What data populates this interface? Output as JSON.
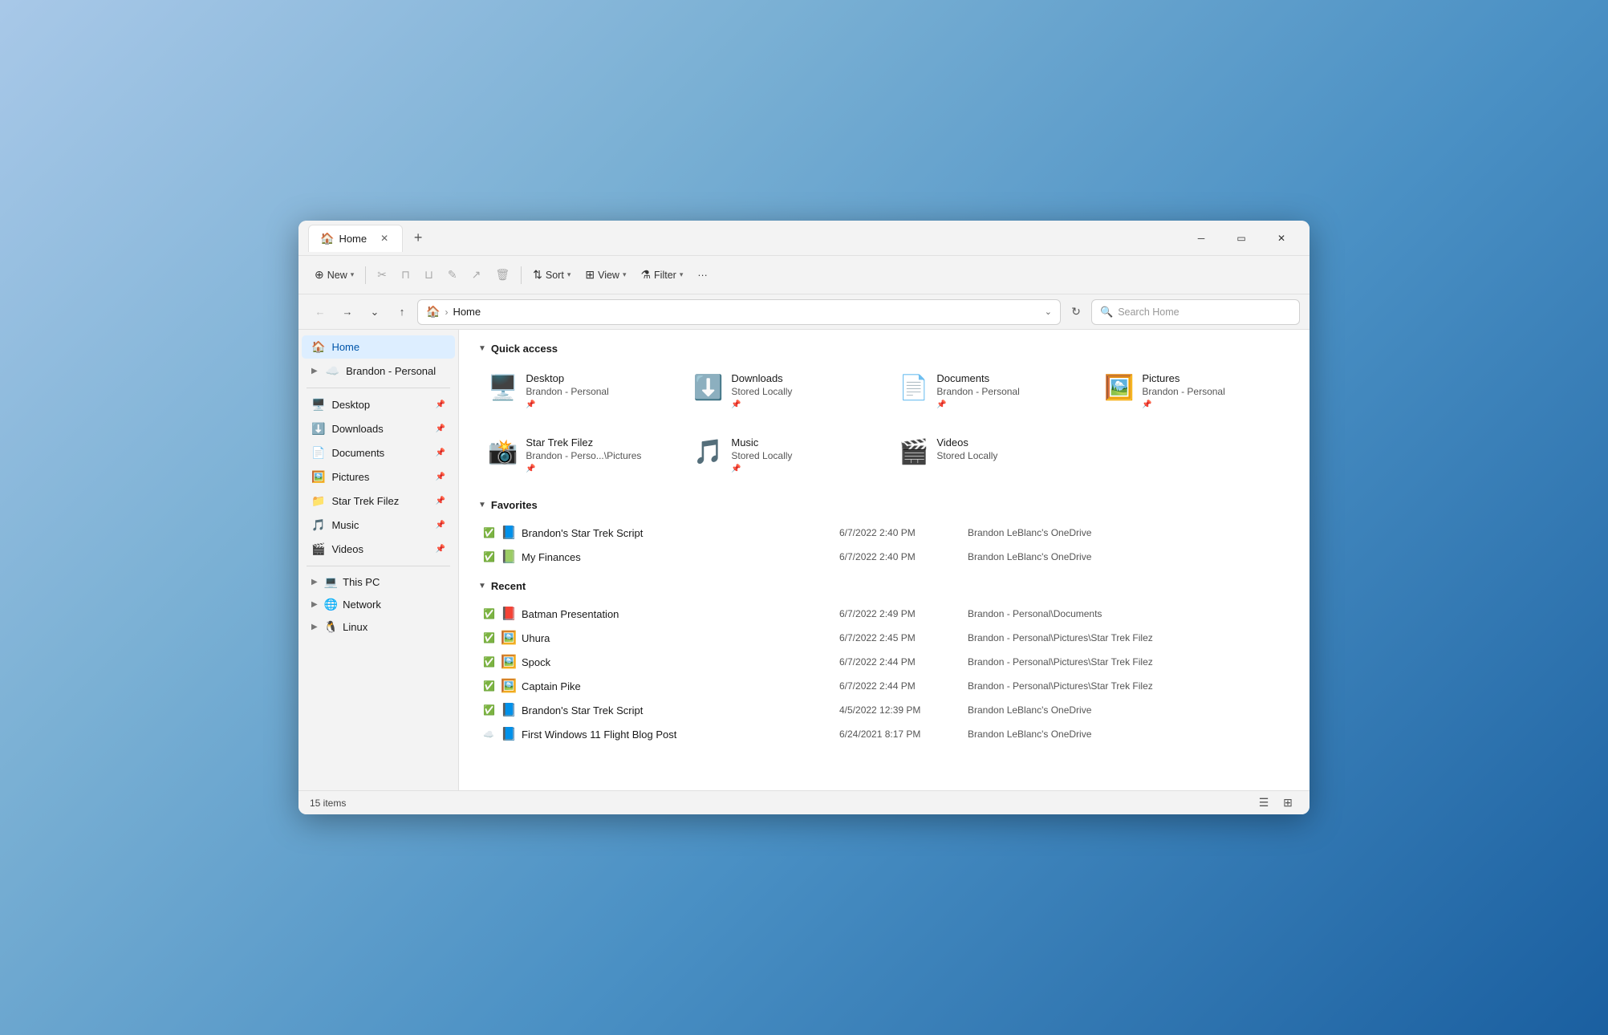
{
  "window": {
    "title": "Home",
    "tab_icon": "🏠"
  },
  "toolbar": {
    "new_label": "New",
    "sort_label": "Sort",
    "view_label": "View",
    "filter_label": "Filter",
    "more_label": "···"
  },
  "address": {
    "home_icon": "🏠",
    "separator": "›",
    "path": "Home",
    "search_placeholder": "Search Home"
  },
  "sidebar": {
    "home_label": "Home",
    "brandon_personal_label": "Brandon - Personal",
    "pinned_items": [
      {
        "icon": "🖥️",
        "label": "Desktop",
        "pin": true
      },
      {
        "icon": "⬇️",
        "label": "Downloads",
        "pin": true
      },
      {
        "icon": "📄",
        "label": "Documents",
        "pin": true
      },
      {
        "icon": "🖼️",
        "label": "Pictures",
        "pin": true
      },
      {
        "icon": "📁",
        "label": "Star Trek Filez",
        "pin": true
      },
      {
        "icon": "🎵",
        "label": "Music",
        "pin": true
      },
      {
        "icon": "🎬",
        "label": "Videos",
        "pin": true
      }
    ],
    "tree_items": [
      {
        "icon": "💻",
        "label": "This PC",
        "expandable": true
      },
      {
        "icon": "🌐",
        "label": "Network",
        "expandable": true
      },
      {
        "icon": "🐧",
        "label": "Linux",
        "expandable": true
      }
    ]
  },
  "quick_access": {
    "section_label": "Quick access",
    "items": [
      {
        "icon": "🖥️",
        "name": "Desktop",
        "sub": "Brandon - Personal",
        "color": "blue"
      },
      {
        "icon": "⬇️",
        "name": "Downloads",
        "sub": "Stored Locally",
        "color": "green"
      },
      {
        "icon": "📄",
        "name": "Documents",
        "sub": "Brandon - Personal",
        "color": "gray"
      },
      {
        "icon": "🖼️",
        "name": "Pictures",
        "sub": "Brandon - Personal",
        "color": "teal"
      },
      {
        "icon": "📸",
        "name": "Star Trek Filez",
        "sub": "Brandon - Perso...\\Pictures",
        "color": "yellow"
      },
      {
        "icon": "🎵",
        "name": "Music",
        "sub": "Stored Locally",
        "color": "orange"
      },
      {
        "icon": "🎬",
        "name": "Videos",
        "sub": "Stored Locally",
        "color": "purple"
      }
    ]
  },
  "favorites": {
    "section_label": "Favorites",
    "items": [
      {
        "status": "✅",
        "icon": "📘",
        "name": "Brandon's Star Trek Script",
        "date": "6/7/2022 2:40 PM",
        "location": "Brandon LeBlanc's OneDrive"
      },
      {
        "status": "✅",
        "icon": "📗",
        "name": "My Finances",
        "date": "6/7/2022 2:40 PM",
        "location": "Brandon LeBlanc's OneDrive"
      }
    ]
  },
  "recent": {
    "section_label": "Recent",
    "items": [
      {
        "status": "✅",
        "icon": "📕",
        "name": "Batman Presentation",
        "date": "6/7/2022 2:49 PM",
        "location": "Brandon - Personal\\Documents"
      },
      {
        "status": "✅",
        "icon": "🖼️",
        "name": "Uhura",
        "date": "6/7/2022 2:45 PM",
        "location": "Brandon - Personal\\Pictures\\Star Trek Filez"
      },
      {
        "status": "✅",
        "icon": "🖼️",
        "name": "Spock",
        "date": "6/7/2022 2:44 PM",
        "location": "Brandon - Personal\\Pictures\\Star Trek Filez"
      },
      {
        "status": "✅",
        "icon": "🖼️",
        "name": "Captain Pike",
        "date": "6/7/2022 2:44 PM",
        "location": "Brandon - Personal\\Pictures\\Star Trek Filez"
      },
      {
        "status": "✅",
        "icon": "📘",
        "name": "Brandon's Star Trek Script",
        "date": "4/5/2022 12:39 PM",
        "location": "Brandon LeBlanc's OneDrive"
      },
      {
        "status": "☁️",
        "icon": "📘",
        "name": "First Windows 11 Flight Blog Post",
        "date": "6/24/2021 8:17 PM",
        "location": "Brandon LeBlanc's OneDrive"
      }
    ]
  },
  "statusbar": {
    "items_count": "15 items"
  },
  "icons": {
    "back": "←",
    "forward": "→",
    "recent_locations": "˅",
    "up": "↑",
    "refresh": "↻",
    "sort": "⇅",
    "view": "⊞",
    "filter": "⚗",
    "cut": "✂",
    "copy": "⊓",
    "paste": "⊔",
    "rename": "✎",
    "share": "↗",
    "delete": "🗑",
    "list_view": "☰",
    "grid_view": "⊞",
    "collapse": "▼"
  }
}
